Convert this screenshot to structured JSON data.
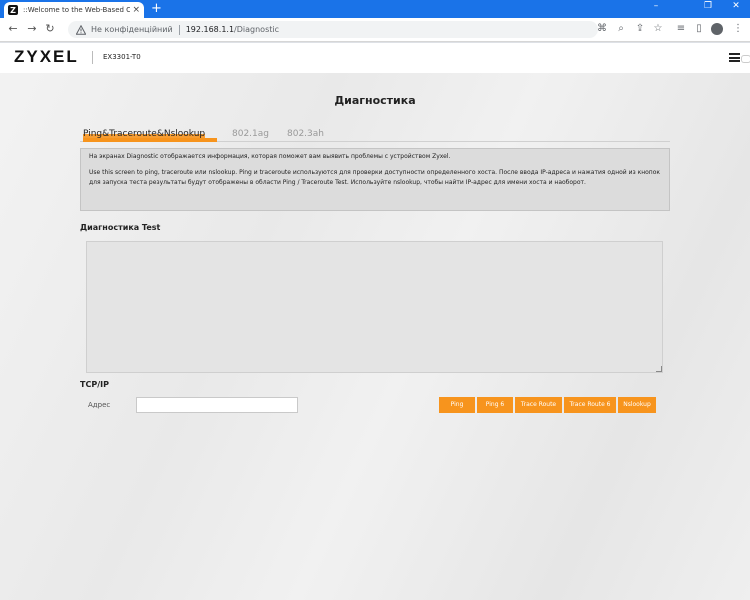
{
  "browser": {
    "tab_favicon": "Z",
    "tab_title": "::Welcome to the Web-Based Co",
    "tab_close": "×",
    "new_tab": "+",
    "win_min": "–",
    "win_max": "❐",
    "win_close": "✕",
    "back": "←",
    "forward": "→",
    "reload": "↻",
    "insecure_label": "Не конфіденційний",
    "url_host": "192.168.1.1",
    "url_path": "/Diagnostic",
    "icons": [
      "translate-icon",
      "zoom-icon",
      "share-icon",
      "star-icon",
      "reading-list-icon",
      "sidebar-icon",
      "profile-icon",
      "menu-icon"
    ]
  },
  "header": {
    "logo": "ZYXEL",
    "model": "EX3301-T0"
  },
  "page": {
    "title": "Диагностика",
    "tabs": [
      {
        "label": "Ping&Traceroute&Nslookup",
        "active": true
      },
      {
        "label": "802.1ag",
        "active": false
      },
      {
        "label": "802.3ah",
        "active": false
      }
    ],
    "info_line1": "На экранах Diagnostic отображается информация, которая поможет вам выявить проблемы с устройством Zyxel.",
    "info_line2": "Use this screen to ping, traceroute или nslookup. Ping и traceroute используются для проверки доступности определенного хоста. После ввода IP-адреса и нажатия одной из кнопок для запуска теста результаты будут отображены в области Ping / Traceroute Test. Используйте nslookup, чтобы найти IP-адрес для имени хоста и наоборот.",
    "test_section": "Диагностика Test",
    "result_text": "",
    "tcpip_section": "TCP/IP",
    "address_label": "Адрес",
    "address_value": "",
    "buttons": {
      "ping": "Ping",
      "ping6": "Ping 6",
      "traceroute": "Trace Route",
      "traceroute6": "Trace Route 6",
      "nslookup": "Nslookup"
    }
  },
  "colors": {
    "accent": "#f7941d",
    "browser_blue": "#1a73e8"
  }
}
